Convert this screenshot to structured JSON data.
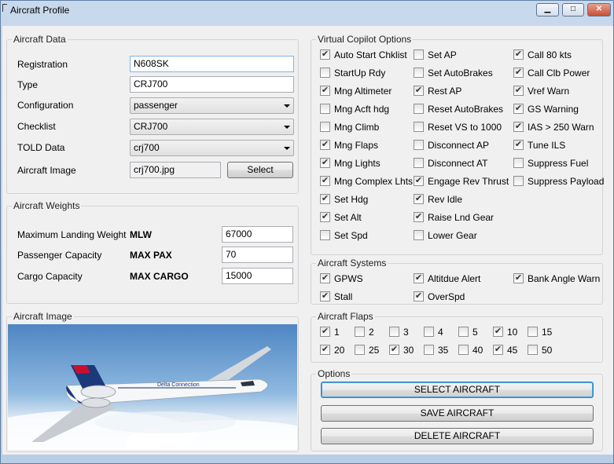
{
  "window": {
    "title": "Aircraft Profile",
    "min_icon": "minimize-icon",
    "max_icon": "maximize-icon",
    "close_icon": "close-icon"
  },
  "aircraft_data": {
    "legend": "Aircraft Data",
    "registration_label": "Registration",
    "registration_value": "N608SK",
    "type_label": "Type",
    "type_value": "CRJ700",
    "configuration_label": "Configuration",
    "configuration_value": "passenger",
    "checklist_label": "Checklist",
    "checklist_value": "CRJ700",
    "told_label": "TOLD Data",
    "told_value": "crj700",
    "image_label": "Aircraft Image",
    "image_value": "crj700.jpg",
    "select_label": "Select"
  },
  "weights": {
    "legend": "Aircraft Weights",
    "rows": [
      {
        "label": "Maximum Landing Weight",
        "code": "MLW",
        "value": "67000"
      },
      {
        "label": "Passenger Capacity",
        "code": "MAX PAX",
        "value": "70"
      },
      {
        "label": "Cargo Capacity",
        "code": "MAX CARGO",
        "value": "15000"
      }
    ]
  },
  "image_panel": {
    "legend": "Aircraft Image",
    "livery_text": "Delta Connection"
  },
  "copilot": {
    "legend": "Virtual Copilot Options",
    "col1": [
      {
        "label": "Auto Start Chklist",
        "checked": true
      },
      {
        "label": "StartUp Rdy",
        "checked": false
      },
      {
        "label": "Mng Altimeter",
        "checked": true
      },
      {
        "label": "Mng Acft hdg",
        "checked": false
      },
      {
        "label": "Mng Climb",
        "checked": false
      },
      {
        "label": "Mng Flaps",
        "checked": true
      },
      {
        "label": "Mng Lights",
        "checked": true
      },
      {
        "label": "Mng Complex Lhts",
        "checked": true
      },
      {
        "label": "Set Hdg",
        "checked": true
      },
      {
        "label": "Set Alt",
        "checked": true
      },
      {
        "label": "Set Spd",
        "checked": false
      }
    ],
    "col2": [
      {
        "label": "Set AP",
        "checked": false
      },
      {
        "label": "Set AutoBrakes",
        "checked": false
      },
      {
        "label": "Rest AP",
        "checked": true
      },
      {
        "label": "Reset AutoBrakes",
        "checked": false
      },
      {
        "label": "Reset VS to 1000",
        "checked": false
      },
      {
        "label": "Disconnect AP",
        "checked": false
      },
      {
        "label": "Disconnect AT",
        "checked": false
      },
      {
        "label": "Engage Rev Thrust",
        "checked": true
      },
      {
        "label": "Rev Idle",
        "checked": true
      },
      {
        "label": "Raise Lnd Gear",
        "checked": true
      },
      {
        "label": "Lower Gear",
        "checked": false
      }
    ],
    "col3": [
      {
        "label": "Call 80 kts",
        "checked": true
      },
      {
        "label": "Call Clb Power",
        "checked": true
      },
      {
        "label": "Vref Warn",
        "checked": true
      },
      {
        "label": "GS Warning",
        "checked": true
      },
      {
        "label": "IAS > 250 Warn",
        "checked": true
      },
      {
        "label": "Tune ILS",
        "checked": true
      },
      {
        "label": "Suppress Fuel",
        "checked": false
      },
      {
        "label": "Suppress Payload",
        "checked": false
      }
    ]
  },
  "systems": {
    "legend": "Aircraft Systems",
    "items": [
      {
        "label": "GPWS",
        "checked": true
      },
      {
        "label": "Altitdue Alert",
        "checked": true
      },
      {
        "label": "Bank Angle Warn",
        "checked": true
      },
      {
        "label": "Stall",
        "checked": true
      },
      {
        "label": "OverSpd",
        "checked": true
      }
    ]
  },
  "flaps": {
    "legend": "Aircraft Flaps",
    "items": [
      {
        "label": "1",
        "checked": true
      },
      {
        "label": "2",
        "checked": false
      },
      {
        "label": "3",
        "checked": false
      },
      {
        "label": "4",
        "checked": false
      },
      {
        "label": "5",
        "checked": false
      },
      {
        "label": "10",
        "checked": true
      },
      {
        "label": "15",
        "checked": false
      },
      {
        "label": "20",
        "checked": true
      },
      {
        "label": "25",
        "checked": false
      },
      {
        "label": "30",
        "checked": true
      },
      {
        "label": "35",
        "checked": false
      },
      {
        "label": "40",
        "checked": false
      },
      {
        "label": "45",
        "checked": true
      },
      {
        "label": "50",
        "checked": false
      }
    ]
  },
  "options": {
    "legend": "Options",
    "select_label": "SELECT AIRCRAFT",
    "save_label": "SAVE AIRCRAFT",
    "delete_label": "DELETE AIRCRAFT"
  },
  "colors": {
    "titlebar": "#c9d9ec",
    "client": "#f0f0f0",
    "focus_border": "#7eb4ea",
    "default_button": "#3c7fb1"
  }
}
